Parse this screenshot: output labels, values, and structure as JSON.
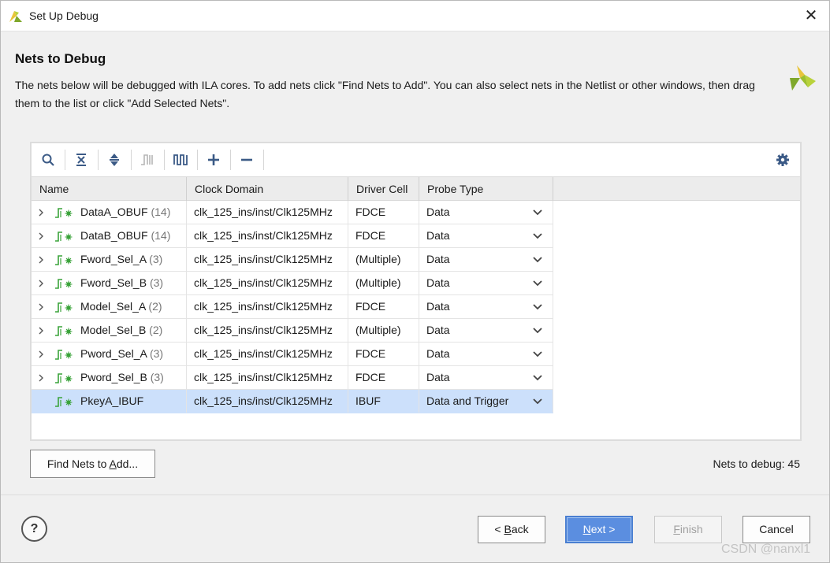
{
  "window": {
    "title": "Set Up Debug",
    "close_glyph": "✕",
    "icon": "vivado-logo-icon"
  },
  "header": {
    "heading": "Nets to Debug",
    "description": "The nets below will be debugged with ILA cores. To add nets click \"Find Nets to Add\". You can also select nets in the Netlist or other windows, then drag them to the list or click \"Add Selected Nets\".",
    "logo": "vivado-logo-icon"
  },
  "toolbar": {
    "items": [
      "search-icon",
      "collapse-all-icon",
      "expand-all-icon",
      "trigger-probe-icon",
      "clock-waveform-icon",
      "add-icon",
      "remove-icon",
      "gear-icon"
    ]
  },
  "table": {
    "columns": [
      "Name",
      "Clock Domain",
      "Driver Cell",
      "Probe Type"
    ],
    "rows": [
      {
        "name": "DataA_OBUF",
        "count": "(14)",
        "clock": "clk_125_ins/inst/Clk125MHz",
        "driver": "FDCE",
        "probe": "Data",
        "expandable": true,
        "selected": false
      },
      {
        "name": "DataB_OBUF",
        "count": "(14)",
        "clock": "clk_125_ins/inst/Clk125MHz",
        "driver": "FDCE",
        "probe": "Data",
        "expandable": true,
        "selected": false
      },
      {
        "name": "Fword_Sel_A",
        "count": "(3)",
        "clock": "clk_125_ins/inst/Clk125MHz",
        "driver": "(Multiple)",
        "probe": "Data",
        "expandable": true,
        "selected": false
      },
      {
        "name": "Fword_Sel_B",
        "count": "(3)",
        "clock": "clk_125_ins/inst/Clk125MHz",
        "driver": "(Multiple)",
        "probe": "Data",
        "expandable": true,
        "selected": false
      },
      {
        "name": "Model_Sel_A",
        "count": "(2)",
        "clock": "clk_125_ins/inst/Clk125MHz",
        "driver": "FDCE",
        "probe": "Data",
        "expandable": true,
        "selected": false
      },
      {
        "name": "Model_Sel_B",
        "count": "(2)",
        "clock": "clk_125_ins/inst/Clk125MHz",
        "driver": "(Multiple)",
        "probe": "Data",
        "expandable": true,
        "selected": false
      },
      {
        "name": "Pword_Sel_A",
        "count": "(3)",
        "clock": "clk_125_ins/inst/Clk125MHz",
        "driver": "FDCE",
        "probe": "Data",
        "expandable": true,
        "selected": false
      },
      {
        "name": "Pword_Sel_B",
        "count": "(3)",
        "clock": "clk_125_ins/inst/Clk125MHz",
        "driver": "FDCE",
        "probe": "Data",
        "expandable": true,
        "selected": false
      },
      {
        "name": "PkeyA_IBUF",
        "count": "",
        "clock": "clk_125_ins/inst/Clk125MHz",
        "driver": "IBUF",
        "probe": "Data and Trigger",
        "expandable": false,
        "selected": true
      }
    ]
  },
  "footer": {
    "find_nets_pre": "Find Nets to ",
    "find_nets_ul": "A",
    "find_nets_post": "dd...",
    "nets_to_debug": "Nets to debug: 45",
    "help": "?",
    "back_pre": "< ",
    "back_ul": "B",
    "back_post": "ack",
    "next_ul": "N",
    "next_post": "ext >",
    "finish_ul": "F",
    "finish_post": "inish",
    "cancel": "Cancel",
    "watermark": "CSDN @nanxl1"
  },
  "colors": {
    "accent": "#5b8ee0",
    "selection": "#cce0fb",
    "net_icon": "#3aa33a"
  }
}
